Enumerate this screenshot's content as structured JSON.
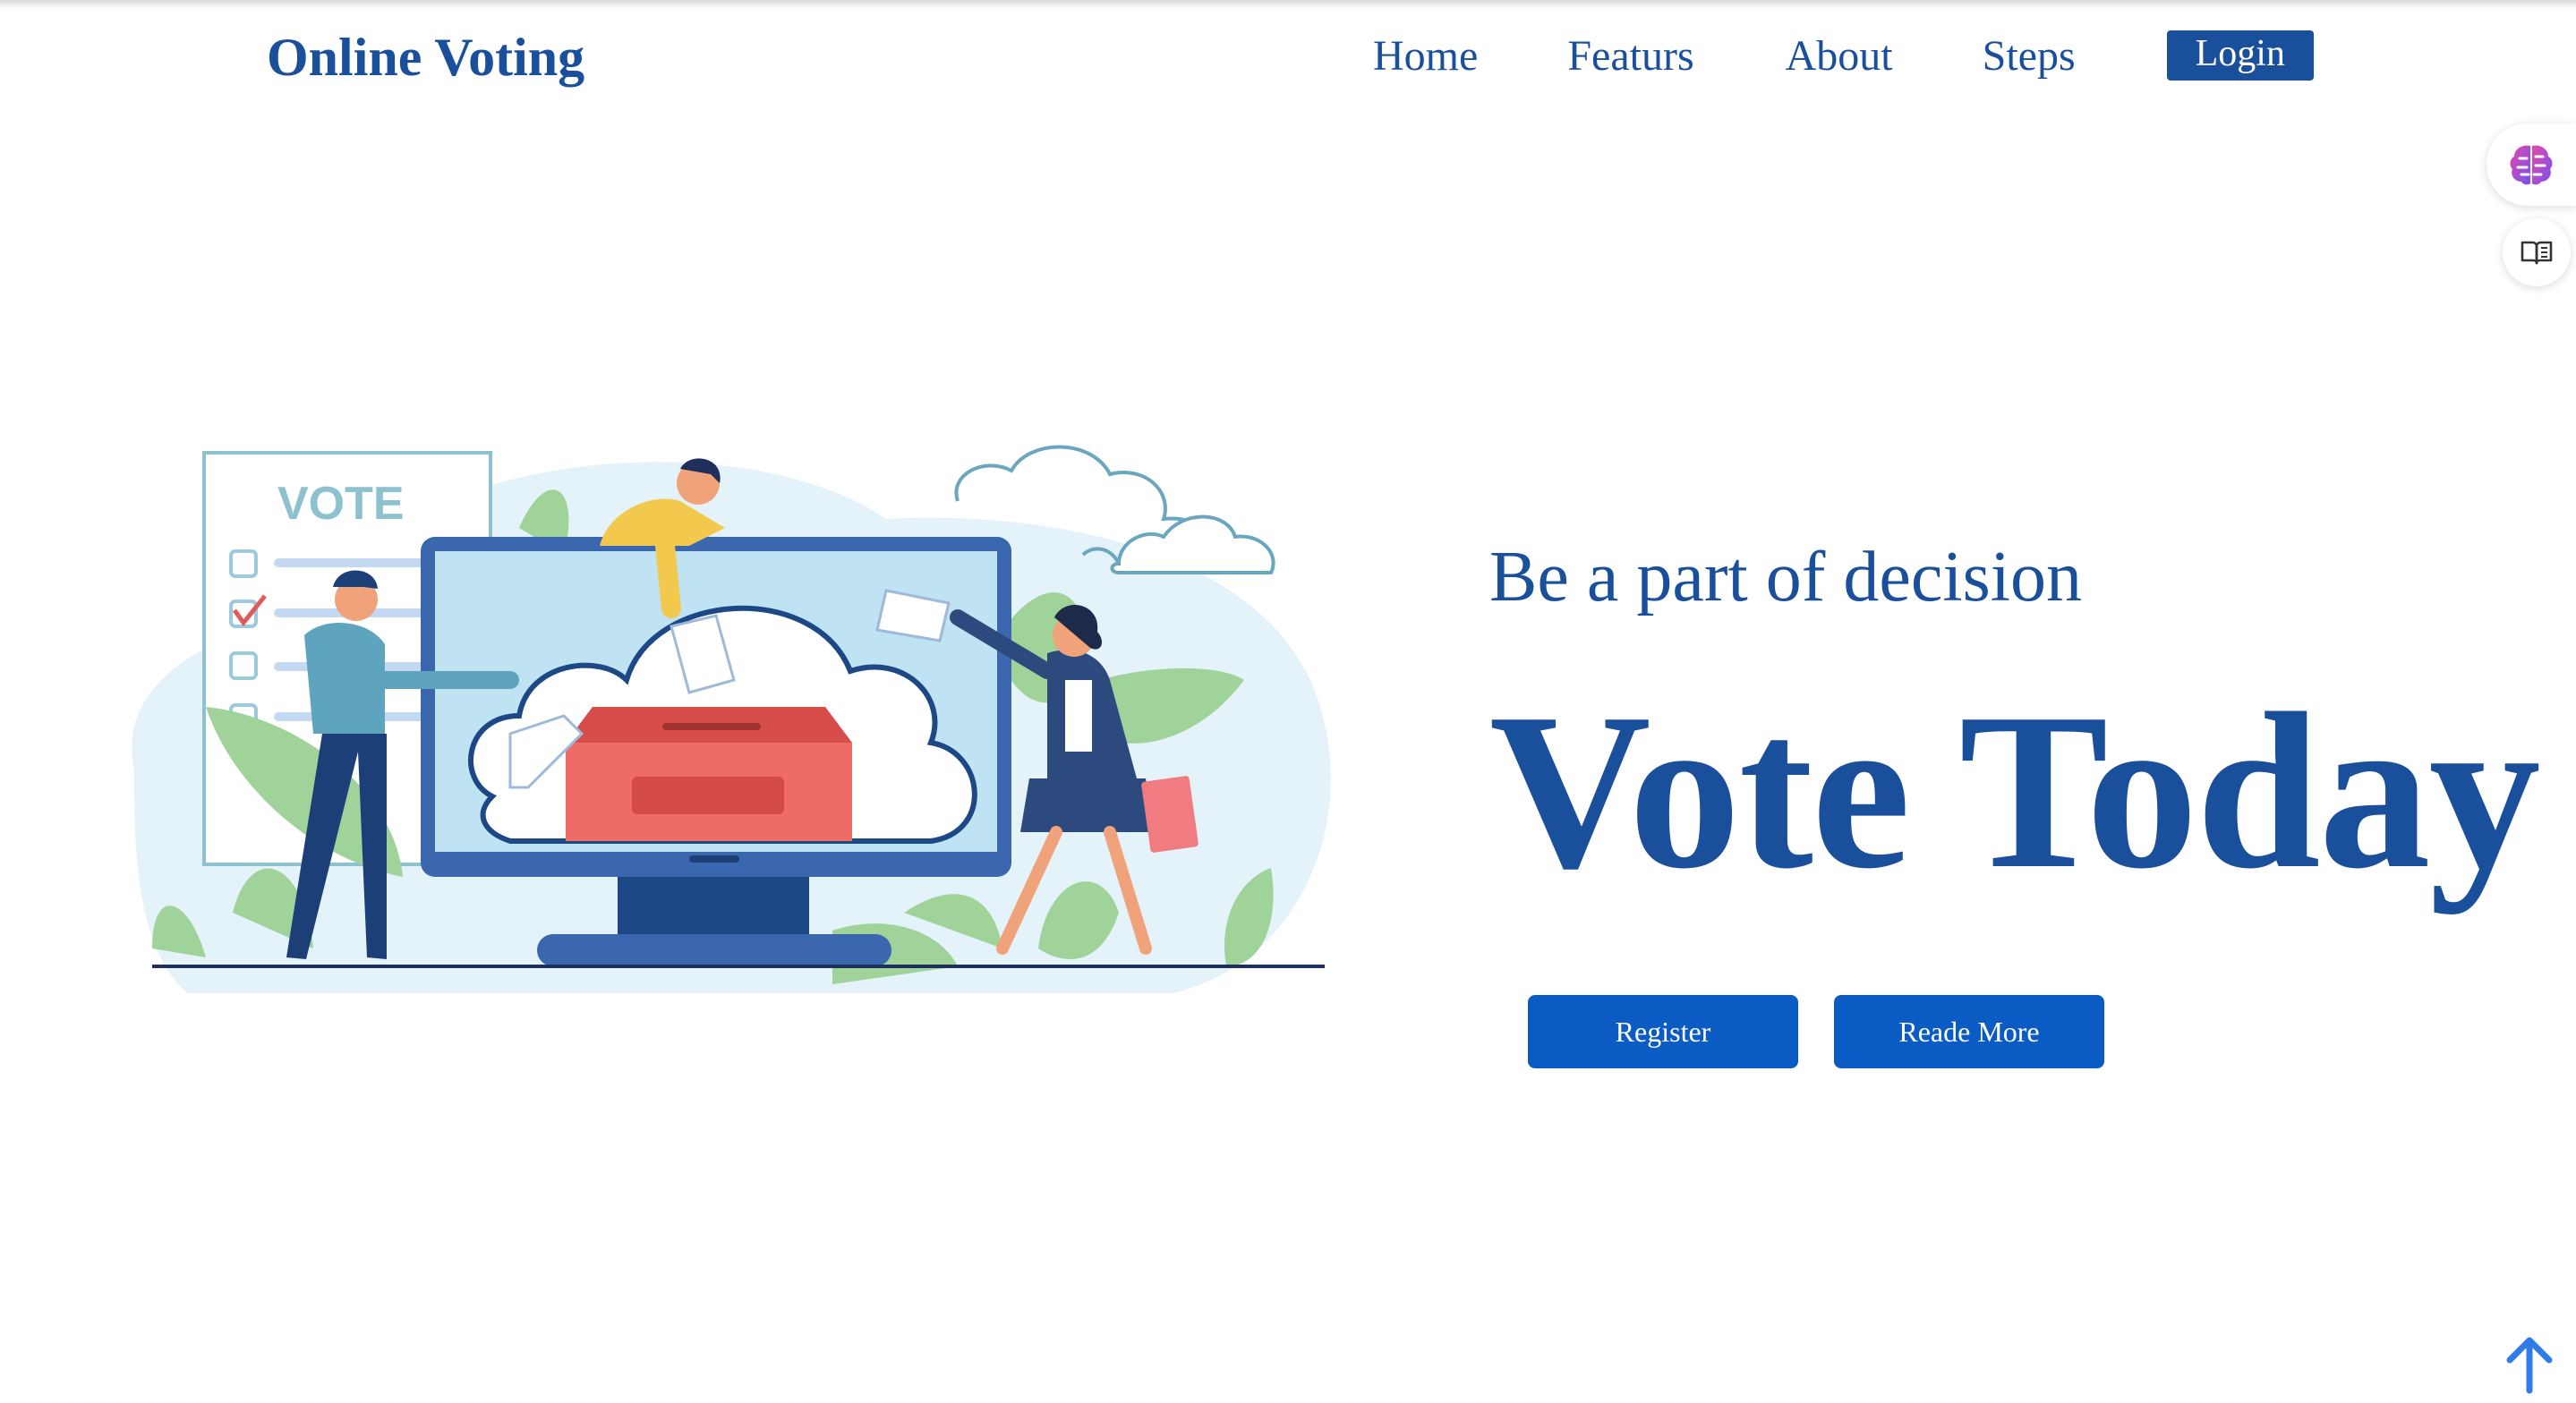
{
  "brand": {
    "title": "Online Voting"
  },
  "nav": {
    "items": [
      {
        "label": "Home"
      },
      {
        "label": "Featurs"
      },
      {
        "label": "About"
      },
      {
        "label": "Steps"
      }
    ],
    "login_label": "Login"
  },
  "hero": {
    "tagline": "Be a part of decision",
    "headline": "Vote Today",
    "buttons": {
      "register_label": "Register",
      "read_more_label": "Reade More"
    },
    "illustration": {
      "ballot_title": "VOTE",
      "icon": "online-voting-illustration"
    }
  },
  "floating": {
    "brain_icon": "brain-icon",
    "book_icon": "reader-book-icon"
  },
  "scroll": {
    "icon": "arrow-up-icon"
  },
  "colors": {
    "brand": "#1a4f9c",
    "button": "#0a5cc4",
    "accent_blue": "#2f7be8"
  }
}
